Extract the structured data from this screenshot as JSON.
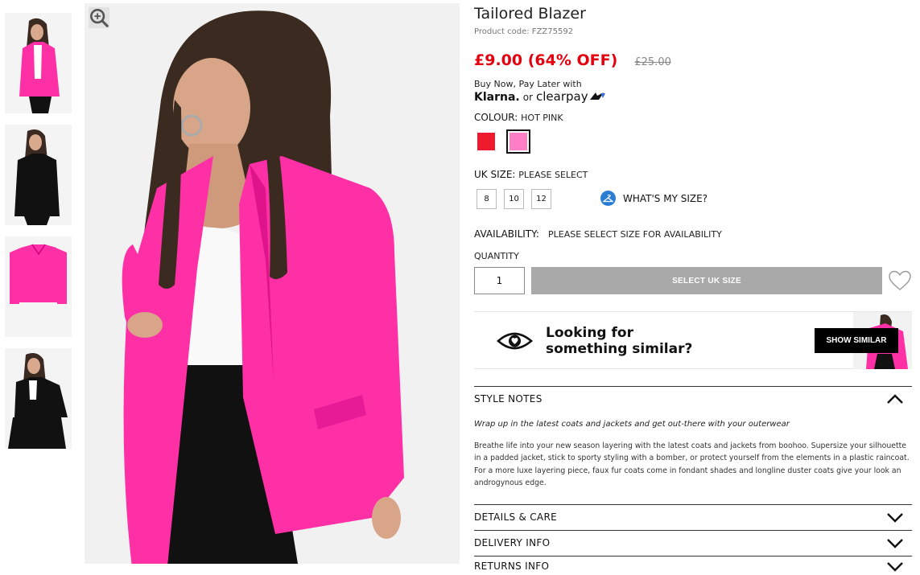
{
  "product": {
    "title": "Tailored Blazer",
    "code": "Product code: FZZ75592",
    "price": "£9.00 (64% OFF)",
    "price_old": "£25.00"
  },
  "payment": {
    "paylater_text": "Buy Now, Pay Later with",
    "klarna": "Klarna.",
    "or": "or",
    "clearpay": "clearpay"
  },
  "colour": {
    "label": "COLOUR:",
    "value": "HOT PINK",
    "swatches": [
      {
        "name": "red",
        "color": "#ee1b2e",
        "selected": false
      },
      {
        "name": "hot-pink",
        "color": "#ff7fc7",
        "selected": true
      }
    ]
  },
  "size": {
    "label": "UK SIZE:",
    "value": "PLEASE SELECT",
    "options": [
      "8",
      "10",
      "12"
    ],
    "whats_my_size": "WHAT'S MY SIZE?"
  },
  "availability": {
    "label": "AVAILABILITY:",
    "value": "PLEASE SELECT SIZE FOR AVAILABILITY"
  },
  "quantity": {
    "label": "QUANTITY",
    "value": "1"
  },
  "actions": {
    "add_label": "SELECT UK SIZE"
  },
  "similar": {
    "line1": "Looking for",
    "line2": "something similar?",
    "button": "SHOW SIMILAR"
  },
  "accordions": {
    "style_notes": "STYLE NOTES",
    "details": "DETAILS & CARE",
    "delivery": "DELIVERY INFO",
    "returns": "RETURNS INFO"
  },
  "style_notes": {
    "subtitle": "Wrap up in the latest coats and jackets and get out-there with your outerwear",
    "body": "Breathe life into your new season layering with the latest coats and jackets from boohoo. Supersize your silhouette in a padded jacket, stick to sporty styling with a bomber, or protect yourself from the elements in a plastic raincoat. For a more luxe layering piece, faux fur coats come in fondant shades and longline duster coats give your look an androgynous edge."
  },
  "colors": {
    "price_red": "#e3000f",
    "blazer_pink": "#ff2fa5",
    "button_grey": "#a9a9a9"
  }
}
